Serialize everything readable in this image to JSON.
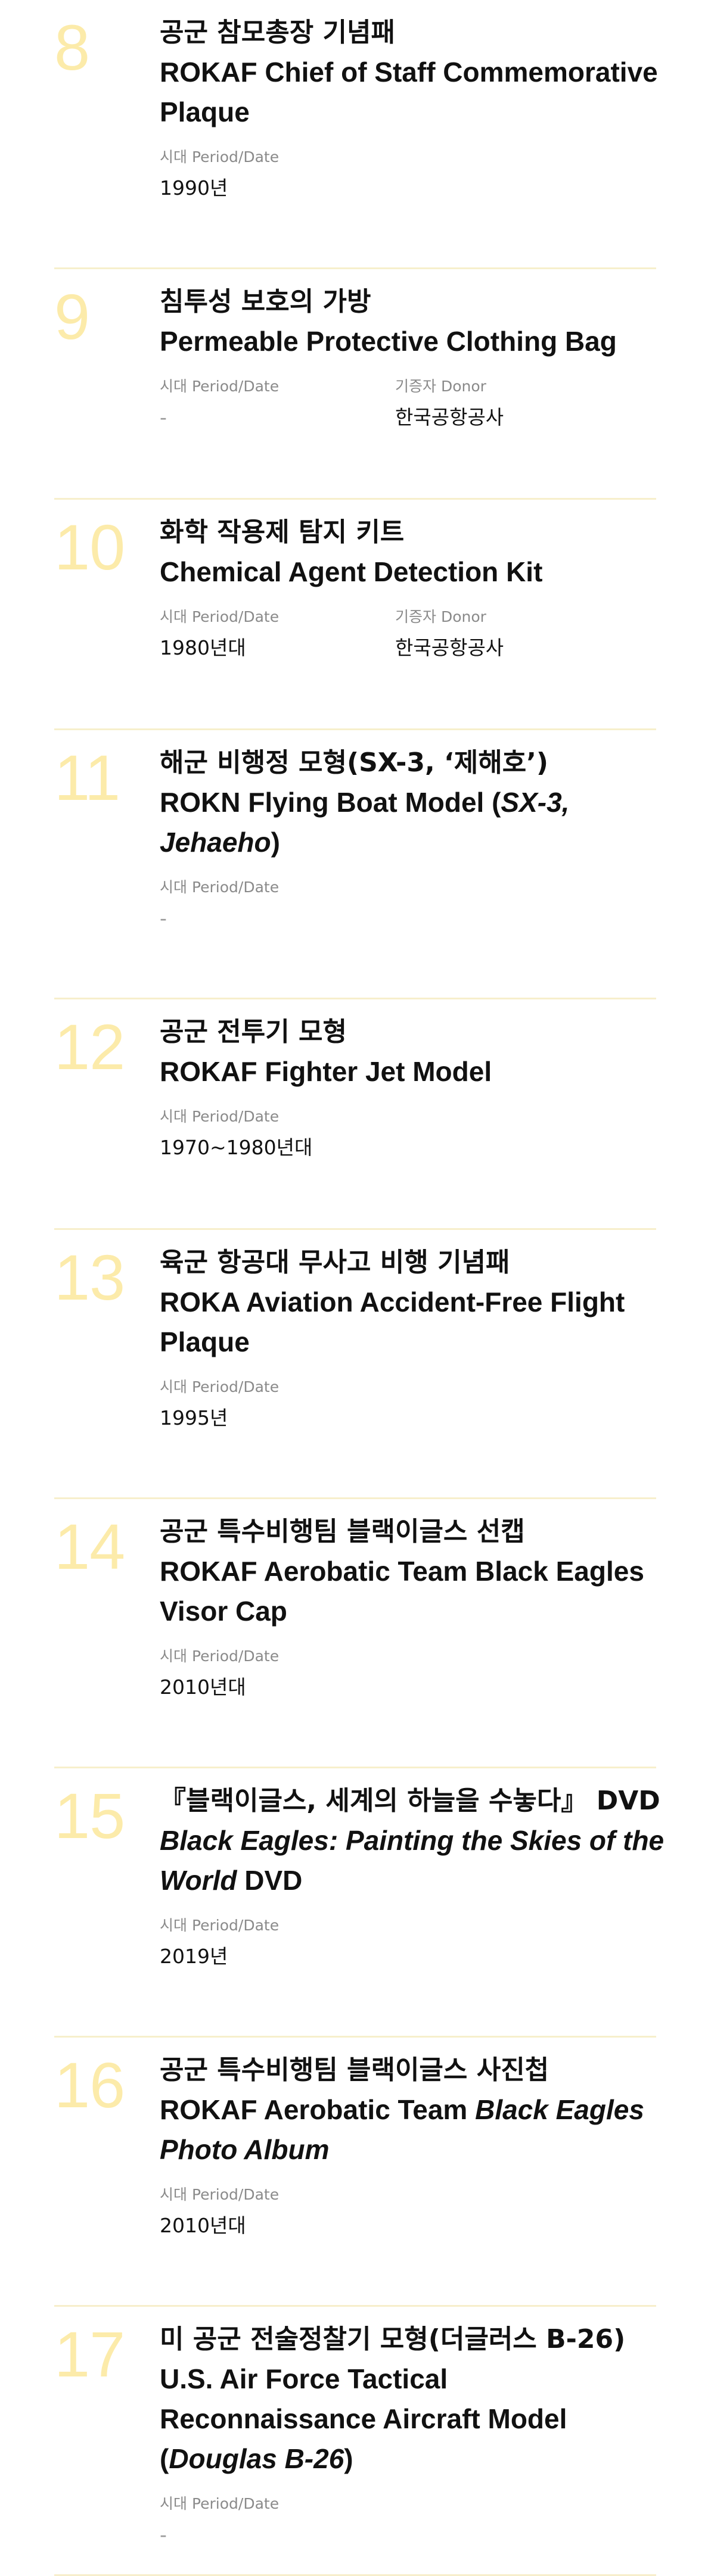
{
  "labels": {
    "period": "시대 Period/Date",
    "donor": "기증자 Donor"
  },
  "items": [
    {
      "number": "8",
      "title_ko": "공군 참모총장 기념패",
      "title_en_parts": [
        {
          "text": "ROKAF Chief of Staff Commemorative Plaque",
          "italic": false
        }
      ],
      "period": "1990년"
    },
    {
      "number": "9",
      "title_ko": "침투성 보호의 가방",
      "title_en_parts": [
        {
          "text": "Permeable Protective Clothing Bag",
          "italic": false
        }
      ],
      "period": "-",
      "donor": "한국공항공사"
    },
    {
      "number": "10",
      "title_ko": "화학 작용제 탐지 키트",
      "title_en_parts": [
        {
          "text": "Chemical Agent Detection Kit",
          "italic": false
        }
      ],
      "period": "1980년대",
      "donor": "한국공항공사"
    },
    {
      "number": "11",
      "title_ko": "해군 비행정 모형(SX-3, ‘제해호’)",
      "title_en_parts": [
        {
          "text": "ROKN Flying Boat Model (",
          "italic": false
        },
        {
          "text": "SX-3, Jehaeho",
          "italic": true
        },
        {
          "text": ")",
          "italic": false
        }
      ],
      "period": "-"
    },
    {
      "number": "12",
      "title_ko": "공군 전투기 모형",
      "title_en_parts": [
        {
          "text": "ROKAF Fighter Jet Model",
          "italic": false
        }
      ],
      "period": "1970~1980년대"
    },
    {
      "number": "13",
      "title_ko": "육군 항공대 무사고 비행 기념패",
      "title_en_parts": [
        {
          "text": "ROKA Aviation Accident-Free Flight Plaque",
          "italic": false
        }
      ],
      "period": "1995년"
    },
    {
      "number": "14",
      "title_ko": "공군 특수비행팀 블랙이글스 선캡",
      "title_en_parts": [
        {
          "text": "ROKAF Aerobatic Team Black Eagles Visor Cap",
          "italic": false
        }
      ],
      "period": "2010년대"
    },
    {
      "number": "15",
      "title_ko": "『블랙이글스, 세계의 하늘을 수놓다』 DVD",
      "title_en_parts": [
        {
          "text": "Black Eagles: Painting the Skies of the World",
          "italic": true
        },
        {
          "text": " DVD",
          "italic": false
        }
      ],
      "period": "2019년"
    },
    {
      "number": "16",
      "title_ko": "공군 특수비행팀 블랙이글스 사진첩",
      "title_en_parts": [
        {
          "text": "ROKAF Aerobatic Team ",
          "italic": false
        },
        {
          "text": "Black Eagles Photo Album",
          "italic": true
        }
      ],
      "period": "2010년대"
    },
    {
      "number": "17",
      "title_ko": "미 공군 전술정찰기 모형(더글러스 B-26)",
      "title_en_parts": [
        {
          "text": "U.S. Air Force Tactical Reconnaissance Aircraft Model (",
          "italic": false
        },
        {
          "text": "Douglas B-26",
          "italic": true
        },
        {
          "text": ")",
          "italic": false
        }
      ],
      "period": "-"
    }
  ]
}
